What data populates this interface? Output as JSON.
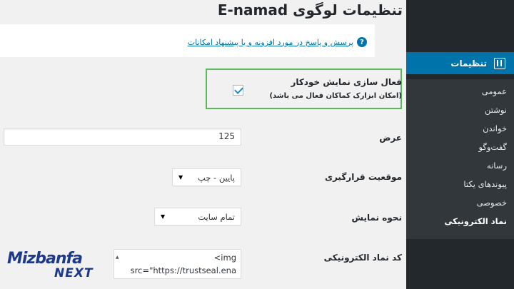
{
  "header": {
    "title": "تنظیمات لوگوی E-namad"
  },
  "notice": {
    "help_link": "پرسش و پاسخ در مورد افزونه و یا پیشنهاد امکانات",
    "help_icon_glyph": "?"
  },
  "sidebar": {
    "current": "تنظیمات",
    "items": [
      {
        "label": "عمومی"
      },
      {
        "label": "نوشتن"
      },
      {
        "label": "خواندن"
      },
      {
        "label": "گفت‌وگو"
      },
      {
        "label": "رسانه"
      },
      {
        "label": "پیوندهای یکتا"
      },
      {
        "label": "خصوصی"
      },
      {
        "label": "نماد الکترونیکی"
      }
    ]
  },
  "form": {
    "auto_display": {
      "title": "فعال سازی نمایش خودکار",
      "subtitle": "(امکان ابزارک کماکان فعال می باشد)",
      "checked": true
    },
    "width": {
      "label": "عرض",
      "value": "125"
    },
    "position": {
      "label": "موقعیت قرارگیری",
      "value": "پایین - چپ"
    },
    "display_mode": {
      "label": "نحوه نمایش",
      "value": "تمام سایت"
    },
    "enamad_code": {
      "label": "کد نماد الکترونیکی",
      "line1": "<img",
      "line2": "src=\"https://trustseal.ena"
    }
  },
  "logo": {
    "main": "Mizbanfa",
    "sub": "NEXT"
  },
  "colors": {
    "accent": "#0073aa",
    "sidebar": "#23282d",
    "highlight": "#5cb85c"
  }
}
